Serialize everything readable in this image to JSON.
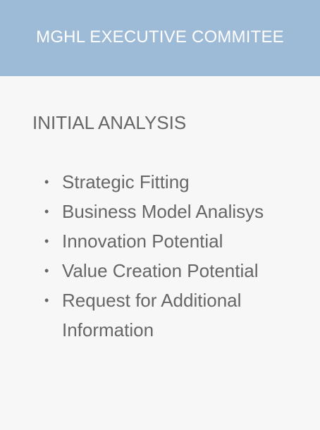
{
  "header": {
    "title": "MGHL EXECUTIVE COMMITEE"
  },
  "section": {
    "title": "INITIAL ANALYSIS",
    "bullet_glyph": "•",
    "items": [
      {
        "label": "Strategic Fitting"
      },
      {
        "label": "Business Model Analisys"
      },
      {
        "label": "Innovation Potential"
      },
      {
        "label": "Value Creation Potential"
      },
      {
        "label": "Request for Additional Information"
      }
    ]
  },
  "colors": {
    "header_bg": "#9dbad6",
    "card_bg": "#f7f7f7",
    "text": "#666666",
    "header_text": "#ffffff"
  }
}
